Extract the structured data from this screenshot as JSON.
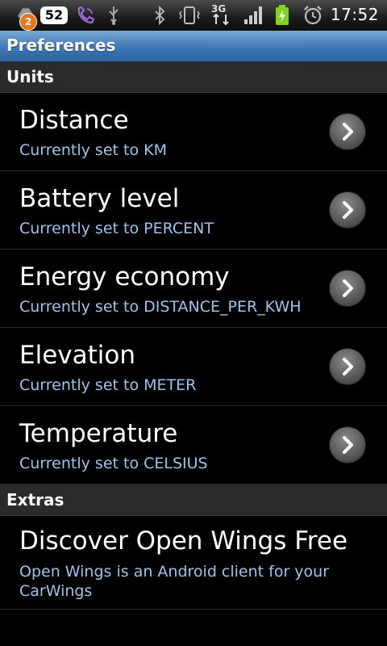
{
  "status_bar": {
    "notification_count": "2",
    "message_count": "52",
    "network": "3G",
    "time": "17:52"
  },
  "title_bar": {
    "title": "Preferences"
  },
  "sections": {
    "units": {
      "label": "Units"
    },
    "extras": {
      "label": "Extras"
    }
  },
  "preferences": [
    {
      "title": "Distance",
      "summary": "Currently set to KM"
    },
    {
      "title": "Battery level",
      "summary": "Currently set to PERCENT"
    },
    {
      "title": "Energy economy",
      "summary": "Currently set to DISTANCE_PER_KWH"
    },
    {
      "title": "Elevation",
      "summary": "Currently set to METER"
    },
    {
      "title": "Temperature",
      "summary": "Currently set to CELSIUS"
    }
  ],
  "extras": {
    "discover": {
      "title": "Discover Open Wings Free",
      "summary": "Open Wings is an Android client for your CarWings"
    }
  },
  "colors": {
    "title_bar": "#3f78b5",
    "summary_text": "#9cc4ea",
    "battery_green": "#7ed321"
  }
}
